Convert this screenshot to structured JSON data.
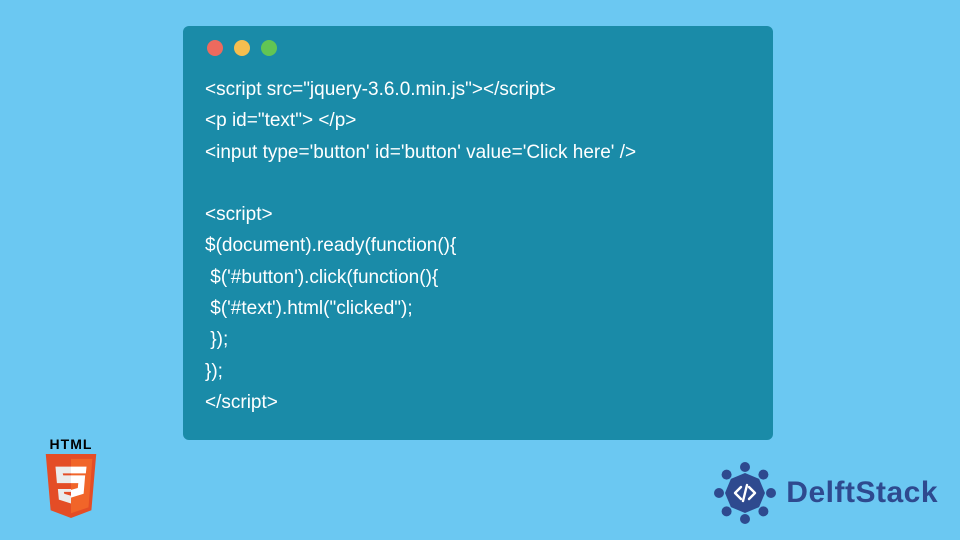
{
  "code": {
    "lines": [
      "<script src=\"jquery-3.6.0.min.js\"></script>",
      "<p id=\"text\"> </p>",
      "<input type='button' id='button' value='Click here' />",
      "",
      "<script>",
      "$(document).ready(function(){",
      " $('#button').click(function(){",
      " $('#text').html(\"clicked\");",
      " });",
      "});",
      "</script>"
    ]
  },
  "logos": {
    "html5_label": "HTML",
    "delftstack": "DelftStack"
  },
  "colors": {
    "background": "#6bc8f2",
    "window": "#1a8ba8",
    "delft_blue": "#2e4a8f"
  }
}
